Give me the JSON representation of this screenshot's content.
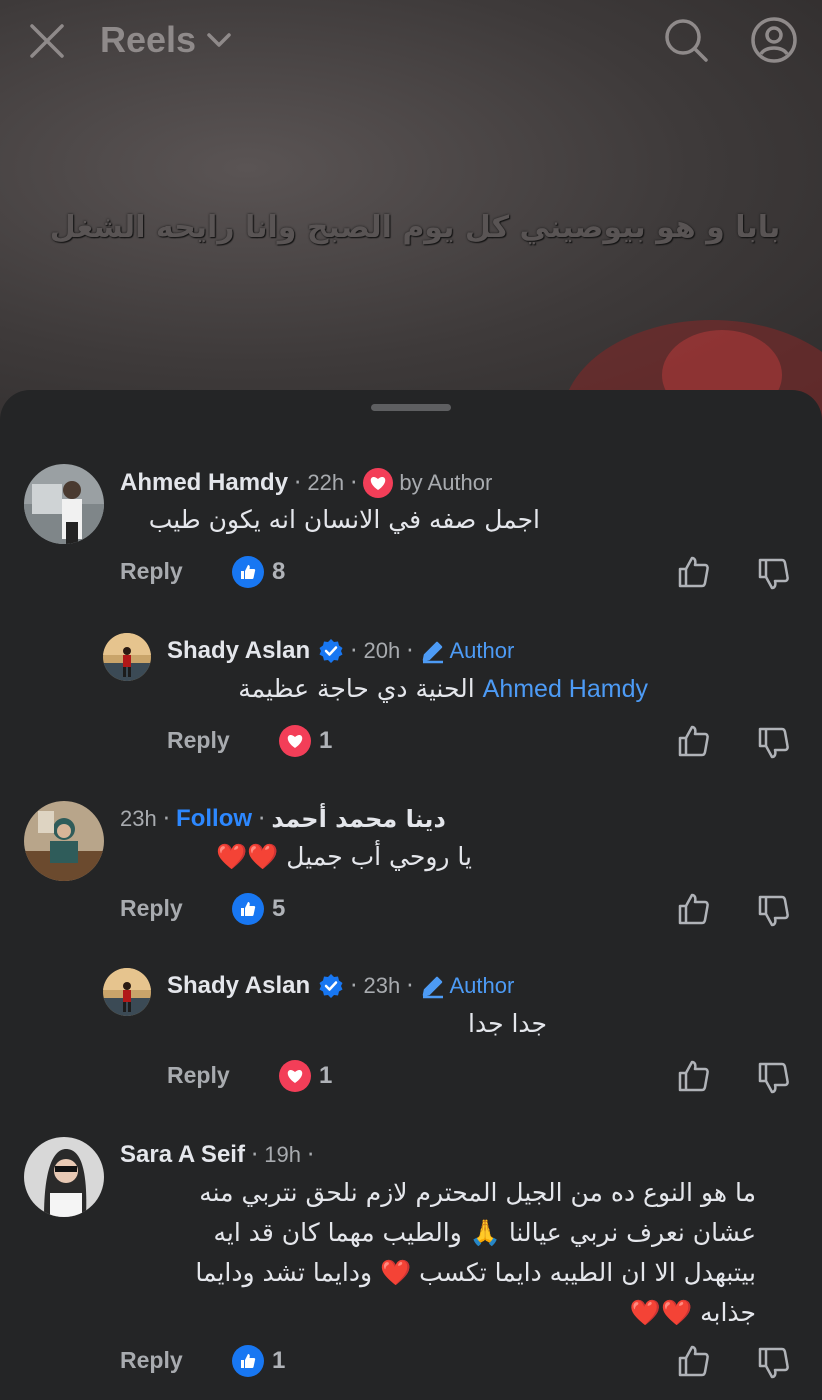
{
  "topbar": {
    "title": "Reels",
    "close_icon": "close-icon",
    "search_icon": "search-icon",
    "profile_icon": "profile-icon"
  },
  "video": {
    "caption": "بابا و هو بيوصيني كل يوم الصبح وانا رايحه الشغل"
  },
  "colors": {
    "sheet_bg": "#242526",
    "link_blue": "#4d9bf5",
    "like_blue": "#1877f2",
    "love_red": "#f33e58"
  },
  "comments": [
    {
      "name": "Ahmed Hamdy",
      "time": "22h",
      "badge": "by Author",
      "text": "اجمل صفه في الانسان انه يكون طيب",
      "reply_label": "Reply",
      "reaction_icon": "like-icon",
      "reaction_count": "8"
    },
    {
      "name": "Shady Aslan",
      "time": "20h",
      "badge": "Author",
      "mention": "Ahmed Hamdy",
      "text": "الحنية دي حاجة عظيمة",
      "reply_label": "Reply",
      "reaction_icon": "love-icon",
      "reaction_count": "1"
    },
    {
      "name": "دينا  محمد أحمد",
      "time": "23h",
      "follow_label": "Follow",
      "text": "يا روحي أب جميل ❤️❤️",
      "reply_label": "Reply",
      "reaction_icon": "like-icon",
      "reaction_count": "5"
    },
    {
      "name": "Shady Aslan",
      "time": "23h",
      "badge": "Author",
      "text": "جدا جدا",
      "reply_label": "Reply",
      "reaction_icon": "love-icon",
      "reaction_count": "1"
    },
    {
      "name": "Sara A Seif",
      "time": "19h",
      "text_lines": [
        "ما هو النوع ده من الجيل المحترم لازم نلحق نتربي منه",
        "عشان نعرف نربي عيالنا 🙏 والطيب مهما كان قد ايه",
        "بيتبهدل الا ان الطيبه دايما تكسب ❤️ ودايما تشد ودايما",
        "جذابه ❤️❤️"
      ],
      "reply_label": "Reply",
      "reaction_icon": "like-icon",
      "reaction_count": "1"
    }
  ]
}
